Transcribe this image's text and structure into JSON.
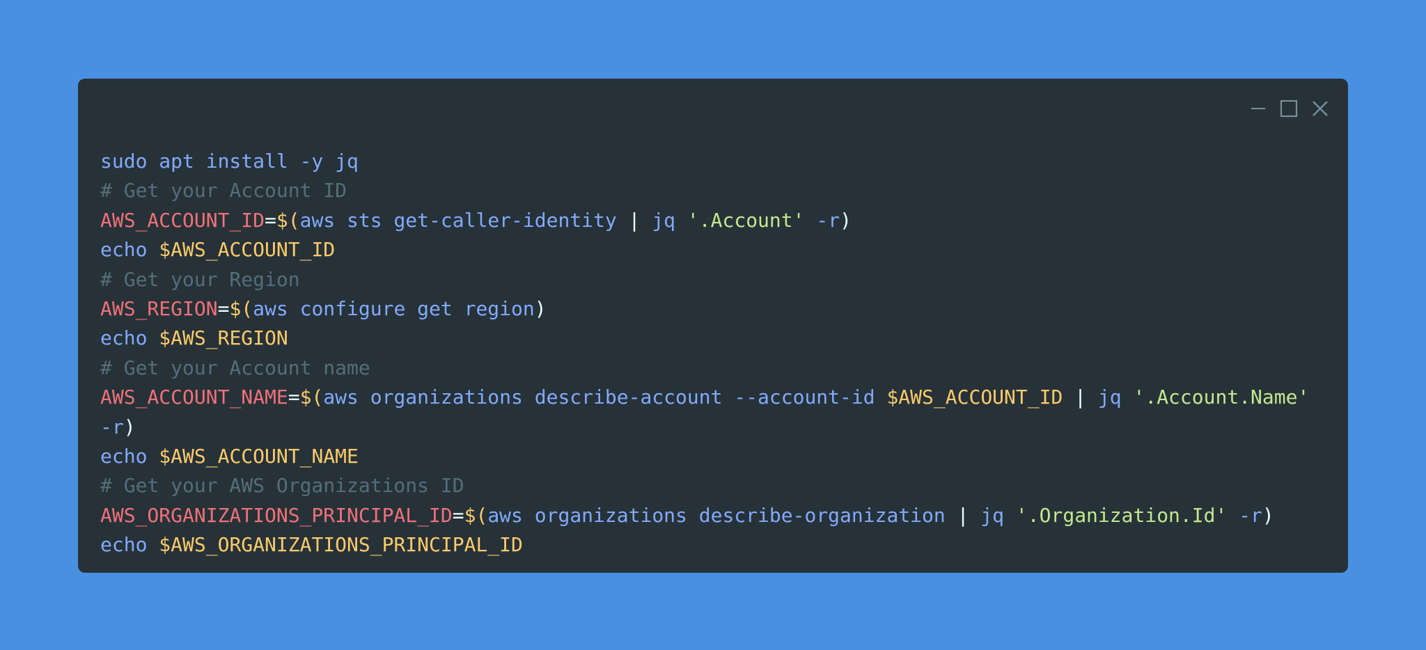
{
  "window": {
    "controls": [
      {
        "name": "minimize",
        "icon": "minimize-icon"
      },
      {
        "name": "maximize",
        "icon": "maximize-icon"
      },
      {
        "name": "close",
        "icon": "close-icon"
      }
    ]
  },
  "colors": {
    "background": "#4a90e2",
    "window": "#263238",
    "command": "#82aaff",
    "comment": "#546e7a",
    "variable": "#f07178",
    "dollar": "#ffcb6b",
    "string": "#c3e88d",
    "punct": "#eeffff",
    "controls": "#78909c"
  },
  "code": {
    "lines": [
      [
        {
          "t": "sudo apt install -y jq",
          "c": "command"
        }
      ],
      [
        {
          "t": "# Get your Account ID",
          "c": "comment"
        }
      ],
      [
        {
          "t": "AWS_ACCOUNT_ID",
          "c": "variable"
        },
        {
          "t": "=",
          "c": "punct"
        },
        {
          "t": "$(",
          "c": "dollar"
        },
        {
          "t": "aws sts get-caller-identity ",
          "c": "command"
        },
        {
          "t": "| ",
          "c": "punct"
        },
        {
          "t": "jq ",
          "c": "command"
        },
        {
          "t": "'.Account'",
          "c": "string"
        },
        {
          "t": " -r",
          "c": "command"
        },
        {
          "t": ")",
          "c": "punct"
        }
      ],
      [
        {
          "t": "echo ",
          "c": "command"
        },
        {
          "t": "$AWS_ACCOUNT_ID",
          "c": "dollar"
        }
      ],
      [
        {
          "t": "# Get your Region",
          "c": "comment"
        }
      ],
      [
        {
          "t": "AWS_REGION",
          "c": "variable"
        },
        {
          "t": "=",
          "c": "punct"
        },
        {
          "t": "$(",
          "c": "dollar"
        },
        {
          "t": "aws configure get region",
          "c": "command"
        },
        {
          "t": ")",
          "c": "punct"
        }
      ],
      [
        {
          "t": "echo ",
          "c": "command"
        },
        {
          "t": "$AWS_REGION",
          "c": "dollar"
        }
      ],
      [
        {
          "t": "# Get your Account name",
          "c": "comment"
        }
      ],
      [
        {
          "t": "AWS_ACCOUNT_NAME",
          "c": "variable"
        },
        {
          "t": "=",
          "c": "punct"
        },
        {
          "t": "$(",
          "c": "dollar"
        },
        {
          "t": "aws organizations describe-account --account-id ",
          "c": "command"
        },
        {
          "t": "$AWS_ACCOUNT_ID",
          "c": "dollar"
        },
        {
          "t": " | ",
          "c": "punct"
        },
        {
          "t": "jq ",
          "c": "command"
        },
        {
          "t": "'.Account.Name'",
          "c": "string"
        },
        {
          "t": "\n",
          "c": "break"
        },
        {
          "t": "-r",
          "c": "command"
        },
        {
          "t": ")",
          "c": "punct"
        }
      ],
      [
        {
          "t": "echo ",
          "c": "command"
        },
        {
          "t": "$AWS_ACCOUNT_NAME",
          "c": "dollar"
        }
      ],
      [
        {
          "t": "# Get your AWS Organizations ID",
          "c": "comment"
        }
      ],
      [
        {
          "t": "AWS_ORGANIZATIONS_PRINCIPAL_ID",
          "c": "variable"
        },
        {
          "t": "=",
          "c": "punct"
        },
        {
          "t": "$(",
          "c": "dollar"
        },
        {
          "t": "aws organizations describe-organization ",
          "c": "command"
        },
        {
          "t": "| ",
          "c": "punct"
        },
        {
          "t": "jq ",
          "c": "command"
        },
        {
          "t": "'.Organization.Id'",
          "c": "string"
        },
        {
          "t": " -r",
          "c": "command"
        },
        {
          "t": ")",
          "c": "punct"
        }
      ],
      [
        {
          "t": "echo ",
          "c": "command"
        },
        {
          "t": "$AWS_ORGANIZATIONS_PRINCIPAL_ID",
          "c": "dollar"
        }
      ]
    ]
  }
}
